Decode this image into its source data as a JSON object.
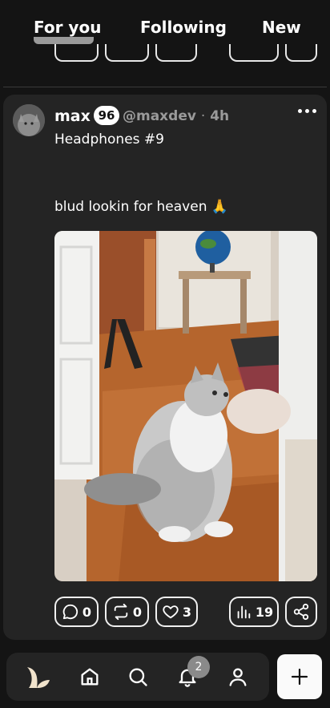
{
  "tabs": [
    {
      "label": "For you",
      "active": true
    },
    {
      "label": "Following",
      "active": false
    },
    {
      "label": "New",
      "active": false
    }
  ],
  "post": {
    "author_name": "max",
    "level": "96",
    "handle": "@maxdev",
    "separator": "·",
    "time": "4h",
    "title": "Headphones #9",
    "body": "blud lookin for heaven 🙏",
    "media_description_icon": "photo-image",
    "actions": {
      "comments": "0",
      "reposts": "0",
      "likes": "3",
      "views": "19"
    }
  },
  "nav": {
    "notifications_count": "2",
    "items": [
      "logo-icon",
      "home-icon",
      "search-icon",
      "bell-icon",
      "profile-icon"
    ]
  },
  "colors": {
    "background": "#141414",
    "card": "#242424",
    "muted": "#9a9a9a",
    "compose": "#fafafa"
  }
}
